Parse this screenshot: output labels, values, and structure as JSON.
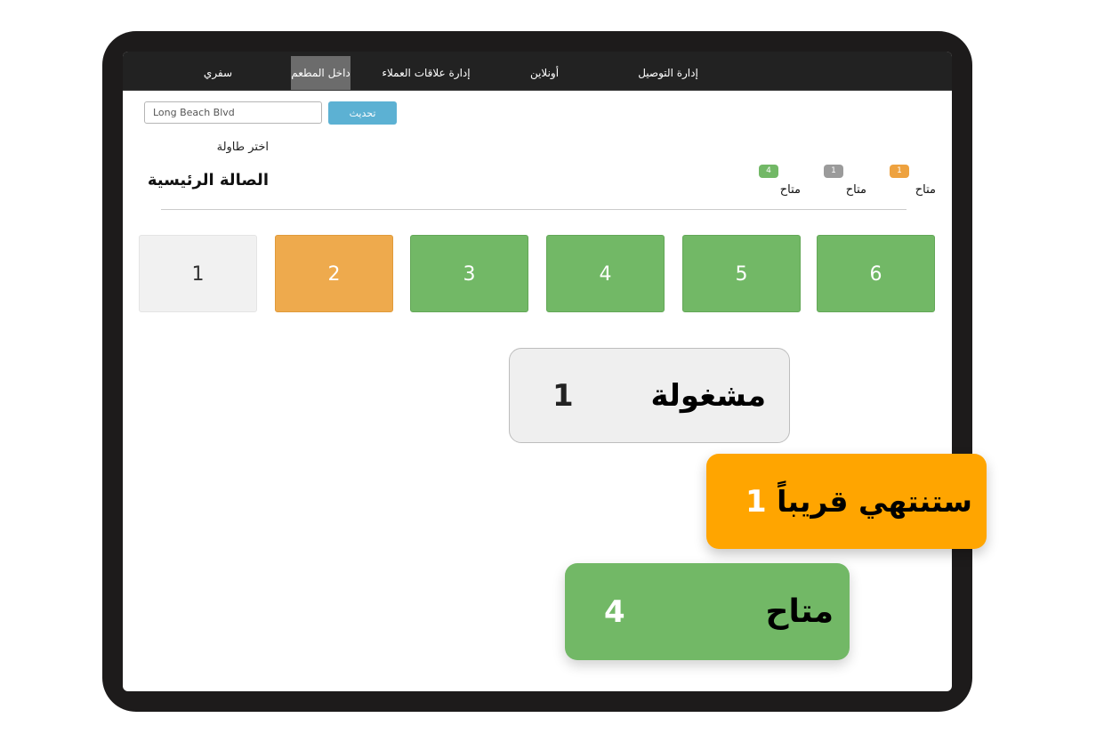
{
  "nav": {
    "items": [
      {
        "label": "سفري"
      },
      {
        "label": "داخل المطعم"
      },
      {
        "label": "إدارة علاقات العملاء"
      },
      {
        "label": "أونلاين"
      },
      {
        "label": "إدارة التوصيل"
      }
    ],
    "active_index": 1
  },
  "search": {
    "value": "Long Beach Blvd"
  },
  "refresh_label": "تحديث",
  "select_table_label": "اختر طاولة",
  "hall_title": "الصالة الرئيسية",
  "legend": [
    {
      "count": "1",
      "label": "متاح",
      "color": "#eea23f"
    },
    {
      "count": "1",
      "label": "متاح",
      "color": "#9b9b9b"
    },
    {
      "count": "4",
      "label": "متاح",
      "color": "#72b866"
    }
  ],
  "tables": [
    {
      "number": "1",
      "status": "busy"
    },
    {
      "number": "2",
      "status": "soon"
    },
    {
      "number": "3",
      "status": "free"
    },
    {
      "number": "4",
      "status": "free"
    },
    {
      "number": "5",
      "status": "free"
    },
    {
      "number": "6",
      "status": "free"
    }
  ],
  "callouts": {
    "busy": {
      "label": "مشغولة",
      "count": "1"
    },
    "soon": {
      "label": "ستنتهي قريباً",
      "count": "1"
    },
    "free": {
      "label": "متاح",
      "count": "4"
    }
  },
  "colors": {
    "free": "#72b866",
    "soon": "#eeaa4d",
    "busy": "#f1f1f1",
    "accent_button": "#5cb1d3",
    "callout_soon": "#ffa500"
  }
}
